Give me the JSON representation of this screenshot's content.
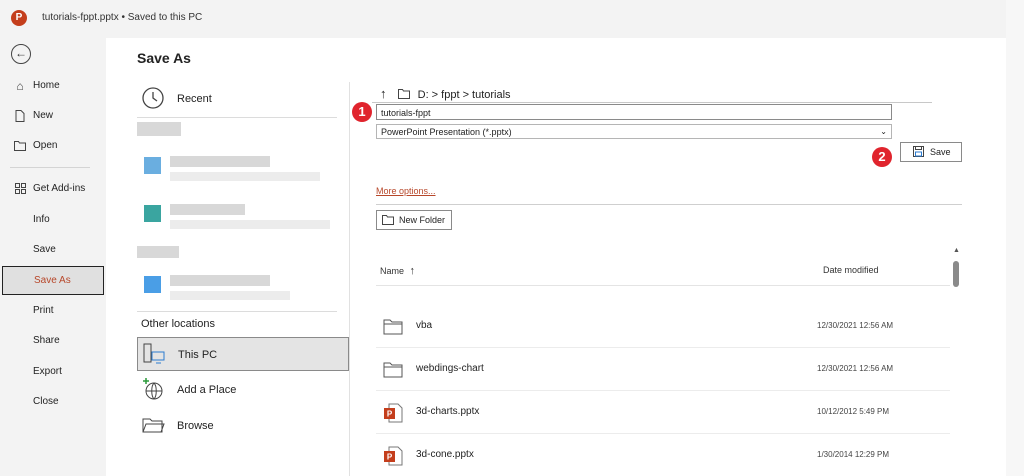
{
  "titlebar": {
    "logo": "P",
    "title": "tutorials-fppt.pptx • Saved to this PC"
  },
  "nav": {
    "back_icon": "back-arrow-icon",
    "items": [
      {
        "label": "Home",
        "icon": "home-icon"
      },
      {
        "label": "New",
        "icon": "new-file-icon"
      },
      {
        "label": "Open",
        "icon": "open-folder-icon"
      },
      {
        "label": "Get Add-ins",
        "icon": "add-ins-icon"
      },
      {
        "label": "Info"
      },
      {
        "label": "Save"
      },
      {
        "label": "Save As"
      },
      {
        "label": "Print"
      },
      {
        "label": "Share"
      },
      {
        "label": "Export"
      },
      {
        "label": "Close"
      }
    ],
    "active": "Save As"
  },
  "panel": {
    "title": "Save As",
    "recent_label": "Recent",
    "other_locations_label": "Other locations",
    "locations": [
      {
        "label": "This PC",
        "icon": "this-pc-icon",
        "selected": true
      },
      {
        "label": "Add a Place",
        "icon": "add-place-icon"
      },
      {
        "label": "Browse",
        "icon": "browse-folder-icon"
      }
    ]
  },
  "path": {
    "up_icon": "up-arrow-icon",
    "folder_icon": "folder-icon",
    "text": "D: >  fppt > tutorials"
  },
  "form": {
    "filename": "tutorials-fppt",
    "filetype": "PowerPoint Presentation (*.pptx)",
    "save_label": "Save",
    "more_options": "More options...",
    "new_folder_label": "New Folder"
  },
  "badges": [
    "1",
    "2"
  ],
  "file_list": {
    "columns": [
      "Name",
      "Date modified"
    ],
    "rows": [
      {
        "name": "vba",
        "date": "12/30/2021 12:56 AM",
        "kind": "folder"
      },
      {
        "name": "webdings-chart",
        "date": "12/30/2021 12:56 AM",
        "kind": "folder"
      },
      {
        "name": "3d-charts.pptx",
        "date": "10/12/2012 5:49 PM",
        "kind": "pptx"
      },
      {
        "name": "3d-cone.pptx",
        "date": "1/30/2014 12:29 PM",
        "kind": "pptx"
      }
    ]
  },
  "colors": {
    "accent": "#b7472a",
    "badge": "#e0242d",
    "ppt": "#c43e1c"
  }
}
